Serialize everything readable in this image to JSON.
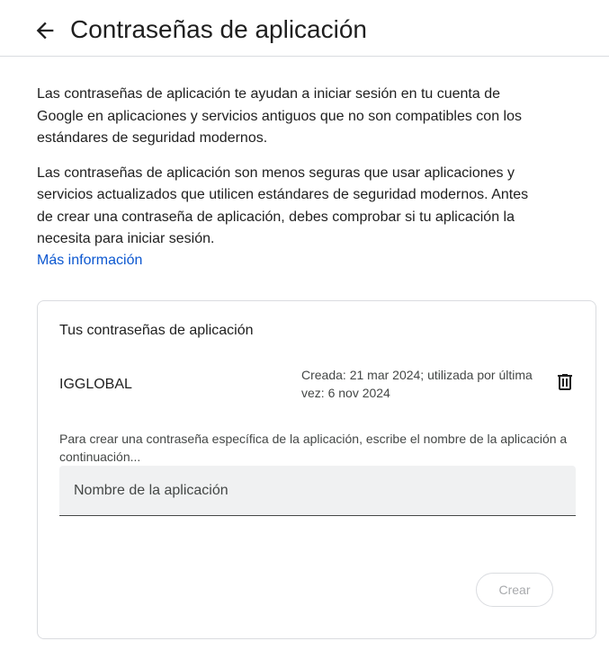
{
  "header": {
    "title": "Contraseñas de aplicación",
    "back_icon": "arrow-left-icon"
  },
  "intro": {
    "paragraph1": "Las contraseñas de aplicación te ayudan a iniciar sesión en tu cuenta de Google en aplicaciones y servicios antiguos que no son compatibles con los estándares de seguridad modernos.",
    "paragraph2": "Las contraseñas de aplicación son menos seguras que usar aplicaciones y servicios actualizados que utilicen estándares de seguridad modernos. Antes de crear una contraseña de aplicación, debes comprobar si tu aplicación la necesita para iniciar sesión.",
    "more_link": "Más información"
  },
  "card": {
    "title": "Tus contraseñas de aplicación",
    "passwords": [
      {
        "name": "IGGLOBAL",
        "meta": "Creada: 21 mar 2024; utilizada por última vez: 6 nov 2024",
        "delete_icon": "trash-icon"
      }
    ],
    "instructions": "Para crear una contraseña específica de la aplicación, escribe el nombre de la aplicación a continuación...",
    "input_placeholder": "Nombre de la aplicación",
    "input_value": "",
    "create_label": "Crear",
    "create_disabled": true
  },
  "colors": {
    "link": "#0b57d0",
    "border": "#dadce0",
    "input_bg": "#f0f1f2",
    "disabled_text": "#a8aaad"
  }
}
